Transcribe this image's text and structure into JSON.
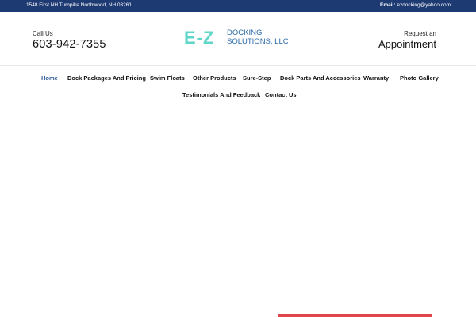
{
  "topbar": {
    "address": "1548 First NH Turnpike Northwood, NH 03261",
    "email_label": "Email:",
    "email": "ezdocking@yahoo.com"
  },
  "header": {
    "call_label": "Call Us",
    "phone": "603-942-7355",
    "logo": {
      "mark": "E-Z",
      "line1": "DOCKING",
      "line2": "SOLUTIONS, LLC"
    },
    "request_label": "Request an",
    "appointment": "Appointment"
  },
  "nav": {
    "items": [
      {
        "label": "Home",
        "active": true
      },
      {
        "label": "Dock Packages And Pricing"
      },
      {
        "label": "Swim Floats"
      },
      {
        "label": "Other Products"
      },
      {
        "label": "Sure-Step"
      },
      {
        "label": "Dock Parts And Accessories"
      },
      {
        "label": "Warranty"
      },
      {
        "label": "Photo Gallery"
      },
      {
        "label": "Testimonials And Feedback"
      },
      {
        "label": "Contact Us"
      }
    ]
  },
  "colors": {
    "topbar": "#1e3a73",
    "accent": "#2b5797",
    "logo_teal": "#5fd6c8",
    "logo_blue": "#2b6aa8",
    "red": "#e0474c"
  }
}
